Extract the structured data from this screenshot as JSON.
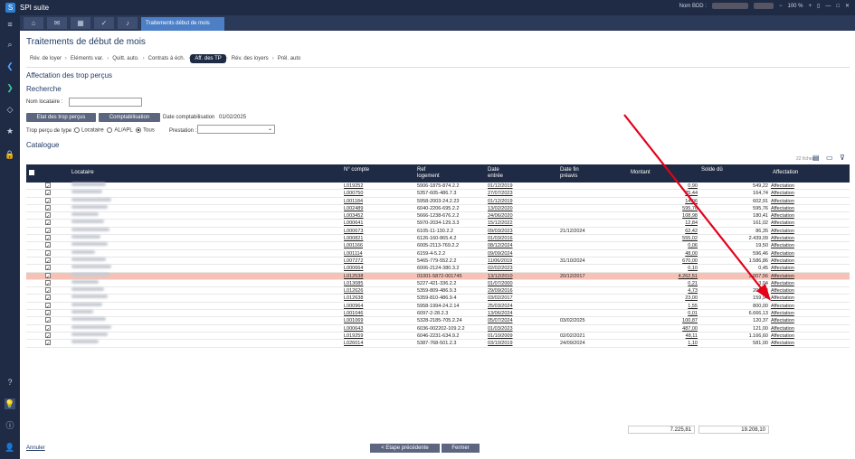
{
  "window": {
    "title": "SPI suite",
    "right_label": "Nom BDD :",
    "zoom": "100 %"
  },
  "tabbar": {
    "active_tab": "Traitements début de mois"
  },
  "page": {
    "title": "Traitements de début de mois",
    "section": "Affectation des trop perçus",
    "search_title": "Recherche",
    "catalogue_title": "Catalogue",
    "count": "22 fiches"
  },
  "steps": [
    "Rév. de loyer",
    "Eléments var.",
    "Quitt. auto.",
    "Contrats à éch.",
    "Aff. des TP",
    "Rév. des loyers",
    "Prél. auto"
  ],
  "search": {
    "locataire_label": "Nom locataire :",
    "btn_etat": "Etat des trop perçus",
    "btn_compta": "Comptabilisation",
    "date_label": "Date comptabilisation",
    "date_value": "01/02/2025",
    "type_label": "Trop perçu de type :",
    "opt_locataire": "Locataire",
    "opt_al": "AL/APL",
    "opt_tous": "Tous",
    "prestation_label": "Prestation :"
  },
  "columns": {
    "locataire": "Locataire",
    "compte": "N° compte",
    "ref": "Ref logement",
    "date_entree": "Date entrée",
    "date_fin": "Date fin préavis",
    "montant": "Montant",
    "solde": "Solde dû",
    "affectation": "Affectation"
  },
  "rows": [
    {
      "compte": "L019252",
      "ref": "5906-1875-874.2.2",
      "entree": "01/12/2019",
      "fin": "",
      "montant": "0,90",
      "solde": "549,22",
      "aff": "Affectation"
    },
    {
      "compte": "L000750",
      "ref": "5357-605-486.7.3",
      "entree": "27/07/2023",
      "fin": "",
      "montant": "25,44",
      "solde": "164,74",
      "aff": "Affectation"
    },
    {
      "compte": "L001184",
      "ref": "5958-2003-24.2.23",
      "entree": "01/12/2019",
      "fin": "",
      "montant": "14,06",
      "solde": "602,91",
      "aff": "Affectation"
    },
    {
      "compte": "L002489",
      "ref": "6040-2206-695.2.2",
      "entree": "13/02/2020",
      "fin": "",
      "montant": "595,76",
      "solde": "595,76",
      "aff": "Affectation"
    },
    {
      "compte": "L003452",
      "ref": "5666-1238-676.2.2",
      "entree": "24/06/2020",
      "fin": "",
      "montant": "108,98",
      "solde": "180,41",
      "aff": "Affectation"
    },
    {
      "compte": "L000641",
      "ref": "5970-2034-129.3.3",
      "entree": "15/12/2022",
      "fin": "",
      "montant": "12,84",
      "solde": "161,02",
      "aff": "Affectation"
    },
    {
      "compte": "L000673",
      "ref": "6105-11-130.2.2",
      "entree": "09/03/2023",
      "fin": "21/12/2024",
      "montant": "62,42",
      "solde": "86,35",
      "aff": "Affectation"
    },
    {
      "compte": "L000821",
      "ref": "6126-160-865.4.2",
      "entree": "01/03/2016",
      "fin": "",
      "montant": "555,02",
      "solde": "2.439,09",
      "aff": "Affectation"
    },
    {
      "compte": "L001166",
      "ref": "6005-2113-769.2.2",
      "entree": "08/12/2024",
      "fin": "",
      "montant": "0,06",
      "solde": "19,50",
      "aff": "Affectation"
    },
    {
      "compte": "L001114",
      "ref": "6159-4-5.2.2",
      "entree": "09/09/2024",
      "fin": "",
      "montant": "48,00",
      "solde": "596,46",
      "aff": "Affectation"
    },
    {
      "compte": "L007272",
      "ref": "5465-779-552.2.2",
      "entree": "11/06/2019",
      "fin": "31/10/2024",
      "montant": "670,00",
      "solde": "1.586,86",
      "aff": "Affectation"
    },
    {
      "compte": "L000664",
      "ref": "6006-2124-380.3.2",
      "entree": "02/02/2023",
      "fin": "",
      "montant": "0,10",
      "solde": "0,45",
      "aff": "Affectation"
    },
    {
      "compte": "L012538",
      "ref": "01001-5872-001745",
      "entree": "13/12/2010",
      "fin": "20/12/2017",
      "montant": "4.262,51",
      "solde": "3.007,56",
      "aff": "Affectation",
      "hl": true
    },
    {
      "compte": "L013085",
      "ref": "5227-421-336.2.2",
      "entree": "01/07/2000",
      "fin": "",
      "montant": "0,21",
      "solde": "3,04",
      "aff": "Affectation"
    },
    {
      "compte": "L012626",
      "ref": "5359-809-486.9.3",
      "entree": "29/09/2016",
      "fin": "",
      "montant": "4,73",
      "solde": "206,03",
      "aff": "Affectation"
    },
    {
      "compte": "L012638",
      "ref": "5359-810-486.9.4",
      "entree": "03/02/2017",
      "fin": "",
      "montant": "23,00",
      "solde": "159,94",
      "aff": "Affectation"
    },
    {
      "compte": "L000964",
      "ref": "5958-1994-24.2.14",
      "entree": "25/03/2024",
      "fin": "",
      "montant": "1,55",
      "solde": "800,00",
      "aff": "Affectation"
    },
    {
      "compte": "L001046",
      "ref": "6097-2-28.2.3",
      "entree": "13/06/2024",
      "fin": "",
      "montant": "0,01",
      "solde": "6.666,13",
      "aff": "Affectation"
    },
    {
      "compte": "L001069",
      "ref": "5328-2185-705.2.24",
      "entree": "05/07/2024",
      "fin": "03/02/2025",
      "montant": "100,87",
      "solde": "120,37",
      "aff": "Affectation"
    },
    {
      "compte": "L000643",
      "ref": "6036-002202-109.2.2",
      "entree": "01/03/2023",
      "fin": "",
      "montant": "487,00",
      "solde": "121,00",
      "aff": "Affectation"
    },
    {
      "compte": "L019259",
      "ref": "6046-2231-634.9.2",
      "entree": "01/10/2009",
      "fin": "02/02/2021",
      "montant": "48,11",
      "solde": "1.166,60",
      "aff": "Affectation"
    },
    {
      "compte": "L026014",
      "ref": "5387-768-501.2.3",
      "entree": "03/10/2019",
      "fin": "24/09/2024",
      "montant": "1,10",
      "solde": "581,00",
      "aff": "Affectation"
    }
  ],
  "totals": {
    "montant": "7.225,81",
    "solde": "19.208,10"
  },
  "footer": {
    "annuler": "Annuler",
    "prev": "< Etape précédente",
    "fermer": "Fermer"
  }
}
